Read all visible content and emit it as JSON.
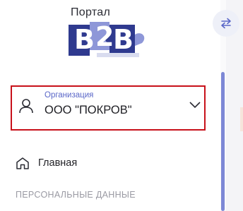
{
  "logo": {
    "title": "Портал",
    "letter_b": "B",
    "digit_2": "2",
    "brand_dark": "#2f3a8f",
    "brand_light": "#8e97d8"
  },
  "header": {
    "collapse_icon": "swap-arrows-icon"
  },
  "organization": {
    "label": "Организация",
    "value": "ООО \"ПОКРОВ\"",
    "icon": "user-icon",
    "chevron": "chevron-down-icon",
    "highlight_color": "#c8111a"
  },
  "nav": {
    "home": {
      "label": "Главная",
      "icon": "home-icon"
    }
  },
  "sections": {
    "personal": "ПЕРСОНАЛЬНЫЕ ДАННЫЕ"
  },
  "colors": {
    "accent": "#5a67c8",
    "scroll_thumb": "#7d88d6"
  }
}
